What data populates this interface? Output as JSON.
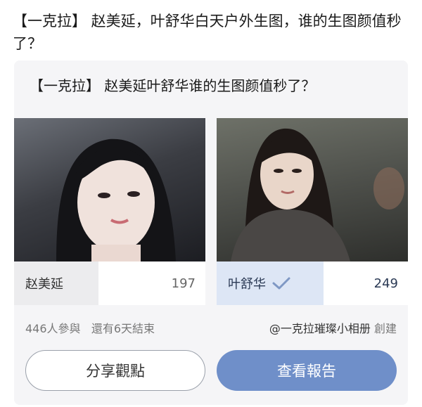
{
  "post": {
    "title": "【一克拉】 赵美延，叶舒华白天户外生图，谁的生图颜值秒了？"
  },
  "poll": {
    "title": "【一克拉】 赵美延叶舒华谁的生图颜值秒了？",
    "options": [
      {
        "name": "赵美延",
        "votes": "197",
        "selected": false
      },
      {
        "name": "叶舒华",
        "votes": "249",
        "selected": true
      }
    ],
    "participants": "446人參與",
    "remaining": "還有6天結束",
    "creator": "@一克拉璀璨小相册",
    "creator_suffix": "創建",
    "share_button": "分享觀點",
    "report_button": "查看報告"
  },
  "colors": {
    "accent": "#6f8fc9",
    "selected_bg": "#dde6f5",
    "card_bg": "#f5f5f7"
  },
  "icons": {
    "selected_check": "checkmark-icon"
  }
}
